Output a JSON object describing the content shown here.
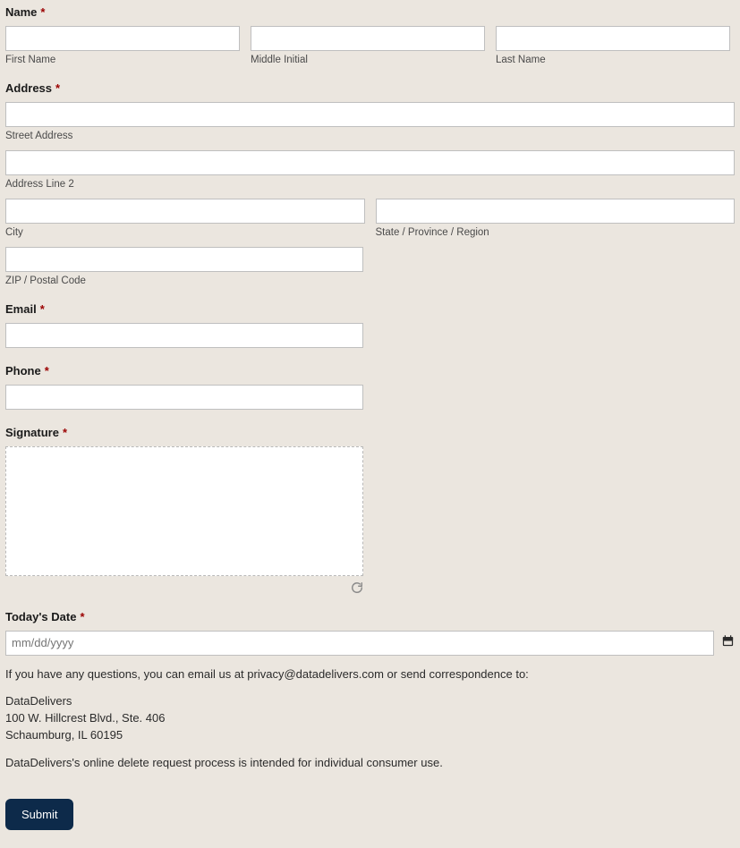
{
  "name": {
    "label": "Name",
    "required": "*",
    "first_sub": "First Name",
    "mi_sub": "Middle Initial",
    "last_sub": "Last Name"
  },
  "address": {
    "label": "Address",
    "required": "*",
    "street_sub": "Street Address",
    "line2_sub": "Address Line 2",
    "city_sub": "City",
    "state_sub": "State / Province / Region",
    "zip_sub": "ZIP / Postal Code"
  },
  "email": {
    "label": "Email",
    "required": "*"
  },
  "phone": {
    "label": "Phone",
    "required": "*"
  },
  "signature": {
    "label": "Signature",
    "required": "*"
  },
  "date": {
    "label": "Today's Date",
    "required": "*",
    "placeholder": "mm/dd/yyyy"
  },
  "info": {
    "line1": "If you have any questions, you can email us at privacy@datadelivers.com or send correspondence to:",
    "addr1": "DataDelivers",
    "addr2": "100 W. Hillcrest Blvd., Ste. 406",
    "addr3": "Schaumburg, IL 60195",
    "line2": "DataDelivers's online delete request process is intended for individual consumer use."
  },
  "submit": {
    "label": "Submit"
  }
}
